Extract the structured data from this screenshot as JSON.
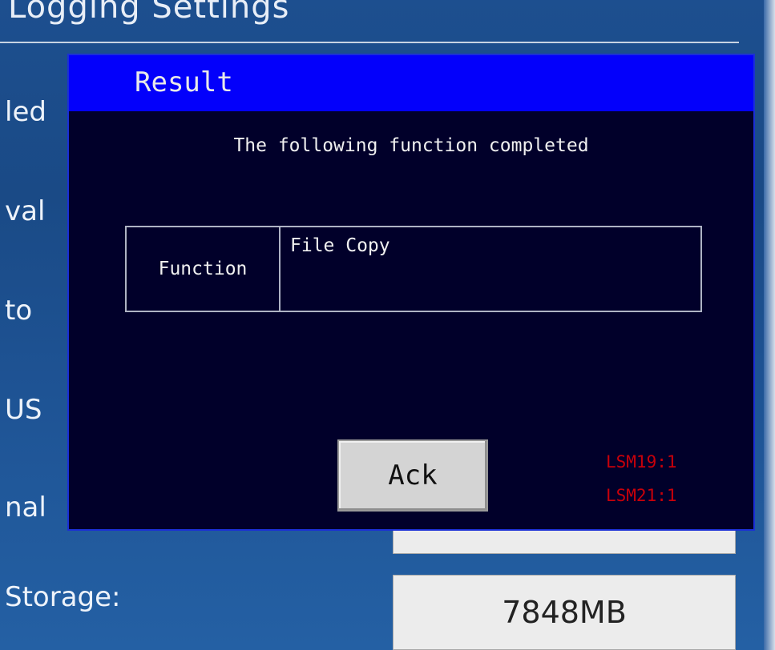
{
  "background": {
    "title": "Logging Settings",
    "labels": [
      "led",
      "val",
      "to",
      "US",
      "nal",
      "Storage:"
    ],
    "storage_value": "7848MB"
  },
  "dialog": {
    "title": "Result",
    "message": "The following function completed",
    "table": {
      "key": "Function",
      "value": "File Copy"
    },
    "ack_label": "Ack",
    "status": [
      "LSM19:1",
      "LSM21:1"
    ]
  },
  "colors": {
    "header_blue": "#0300fb",
    "dialog_bg": "#01002a",
    "status_red": "#c8000a"
  }
}
